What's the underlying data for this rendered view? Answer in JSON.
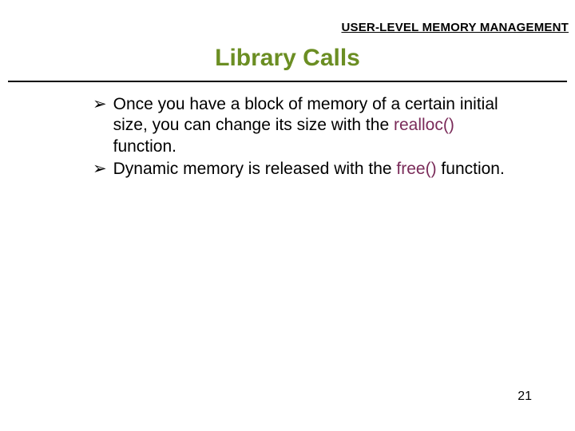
{
  "header": {
    "topic": "USER-LEVEL MEMORY MANAGEMENT"
  },
  "title": "Library Calls",
  "bullets": [
    {
      "marker": "➢",
      "pre": "Once you have a block of memory of a certain initial size, you can change its size with the ",
      "fn": "realloc()",
      "post": " function."
    },
    {
      "marker": "➢",
      "pre": "Dynamic memory is released with the ",
      "fn": "free()",
      "post": " function."
    }
  ],
  "page_number": "21"
}
